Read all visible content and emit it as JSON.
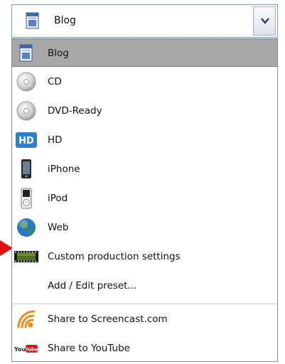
{
  "combo": {
    "selected_label": "Blog",
    "selected_icon": "blog-doc-icon",
    "dropdown_icon": "chevron-down-icon"
  },
  "presets": [
    {
      "label": "Blog",
      "icon": "blog-doc-icon",
      "selected": true
    },
    {
      "label": "CD",
      "icon": "cd-disc-icon"
    },
    {
      "label": "DVD-Ready",
      "icon": "dvd-disc-icon"
    },
    {
      "label": "HD",
      "icon": "hd-badge-icon"
    },
    {
      "label": "iPhone",
      "icon": "iphone-icon"
    },
    {
      "label": "iPod",
      "icon": "ipod-icon"
    },
    {
      "label": "Web",
      "icon": "globe-icon"
    },
    {
      "label": "Custom production settings",
      "icon": "film-strip-icon"
    },
    {
      "label": "Add / Edit preset...",
      "icon": ""
    }
  ],
  "share": [
    {
      "label": "Share to Screencast.com",
      "icon": "screencast-rss-icon"
    },
    {
      "label": "Share to YouTube",
      "icon": "youtube-logo-icon"
    }
  ],
  "colors": {
    "selection_bg": "#a8a8a8",
    "youtube_red": "#cc1f1f",
    "arrow_red": "#e01010"
  }
}
